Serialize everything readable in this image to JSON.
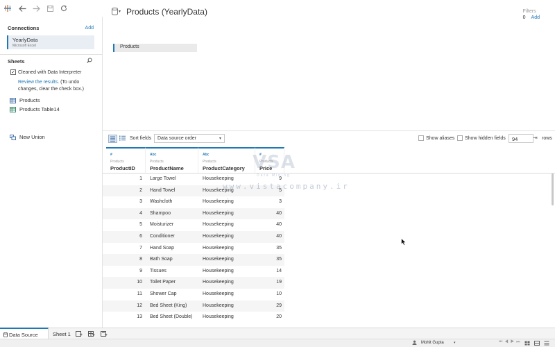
{
  "datasource": {
    "title": "Products (YearlyData)"
  },
  "filters": {
    "label": "Filters",
    "count": "0",
    "add_label": "Add"
  },
  "sidebar": {
    "connections_label": "Connections",
    "connections_add": "Add",
    "connection": {
      "name": "YearlyData",
      "type": "Microsoft Excel"
    },
    "sheets_label": "Sheets",
    "interpreter_label": "Cleaned with Data Interpreter",
    "interpreter_checked": true,
    "review_link": "Review the results.",
    "review_note": " (To undo changes, clear the check box.)",
    "sheets": [
      {
        "label": "Products",
        "icon": "sheet-icon"
      },
      {
        "label": "Products Table14",
        "icon": "table-extract-icon"
      }
    ],
    "new_union": "New Union"
  },
  "canvas": {
    "table_pill": "Products"
  },
  "grid_toolbar": {
    "sort_label": "Sort fields",
    "sort_value": "Data source order",
    "show_aliases": "Show aliases",
    "show_hidden": "Show hidden fields",
    "rows_value": "94",
    "rows_label": "rows"
  },
  "grid": {
    "columns": [
      {
        "type": "#",
        "source": "Products",
        "name": "ProductID"
      },
      {
        "type": "Abc",
        "source": "Products",
        "name": "ProductName"
      },
      {
        "type": "Abc",
        "source": "Products",
        "name": "ProductCategory"
      },
      {
        "type": "#",
        "source": "Products",
        "name": "Price"
      }
    ],
    "rows": [
      [
        "1",
        "Large Towel",
        "Housekeeping",
        "9"
      ],
      [
        "2",
        "Hand Towel",
        "Housekeeping",
        "5"
      ],
      [
        "3",
        "Washcloth",
        "Housekeeping",
        "3"
      ],
      [
        "4",
        "Shampoo",
        "Housekeeping",
        "40"
      ],
      [
        "5",
        "Moisturizer",
        "Housekeeping",
        "40"
      ],
      [
        "6",
        "Conditioner",
        "Housekeeping",
        "40"
      ],
      [
        "7",
        "Hand Soap",
        "Housekeeping",
        "35"
      ],
      [
        "8",
        "Bath Soap",
        "Housekeeping",
        "35"
      ],
      [
        "9",
        "Tissues",
        "Housekeeping",
        "14"
      ],
      [
        "10",
        "Toilet Paper",
        "Housekeeping",
        "19"
      ],
      [
        "11",
        "Shower Cap",
        "Housekeeping",
        "10"
      ],
      [
        "12",
        "Bed Sheet (King)",
        "Housekeeping",
        "29"
      ],
      [
        "13",
        "Bed Sheet (Double)",
        "Housekeeping",
        "20"
      ]
    ]
  },
  "watermark": {
    "letters": "VSA",
    "subtitle": "Data Mining",
    "url": "www.vistacompany.ir"
  },
  "tabs": {
    "data_source": "Data Source",
    "sheet1": "Sheet 1"
  },
  "status": {
    "user": "Mohit Gupta"
  },
  "colors": {
    "accent": "#1f77b4"
  }
}
